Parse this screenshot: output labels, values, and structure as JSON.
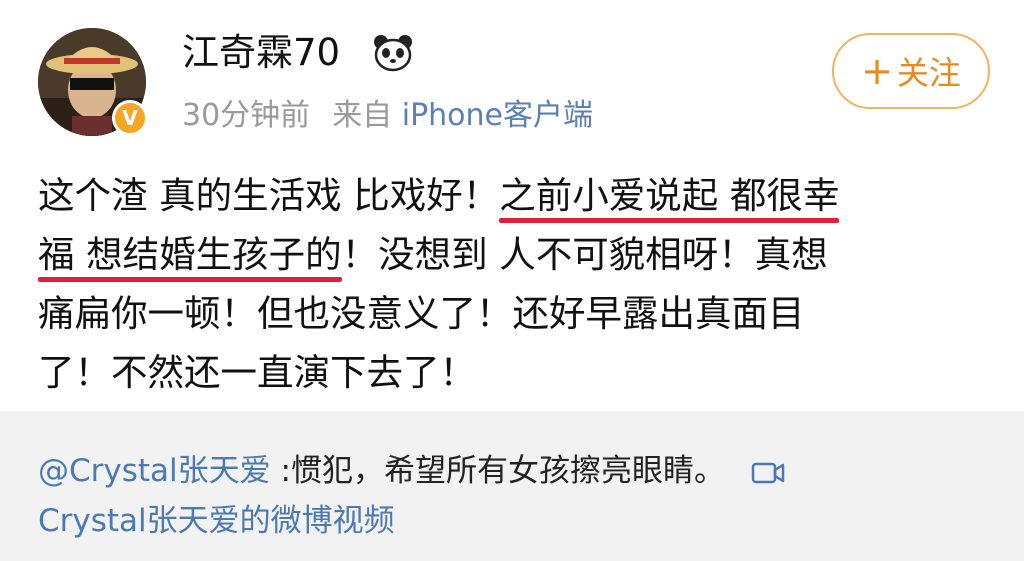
{
  "user": {
    "name": "江奇霖70",
    "verified_badge": "V",
    "badge_icon": "panda-icon",
    "time": "30分钟前",
    "source_prefix": "来自",
    "source": "iPhone客户端"
  },
  "follow_button": {
    "label": "关注",
    "icon": "plus-icon"
  },
  "post": {
    "line1_a": "这个渣 真的生活戏 比戏好！",
    "line1_b": "之前小爱说起 都很幸",
    "line2_a": "福 想结婚生孩子的",
    "line2_b": "！没想到 人不可貌相呀！真想",
    "line3": "痛扁你一顿！但也没意义了！还好早露出真面目",
    "line4": "了！不然还一直演下去了！"
  },
  "repost": {
    "mention": "@Crystal张天爱",
    "text": " :惯犯，希望所有女孩擦亮眼睛。",
    "video_icon": "video-icon",
    "video_link": "Crystal张天爱的微博视频"
  },
  "colors": {
    "highlight_underline": "#e3203a",
    "follow_accent": "#e98a1f",
    "link": "#4d79b3",
    "verified": "#f5a623"
  }
}
